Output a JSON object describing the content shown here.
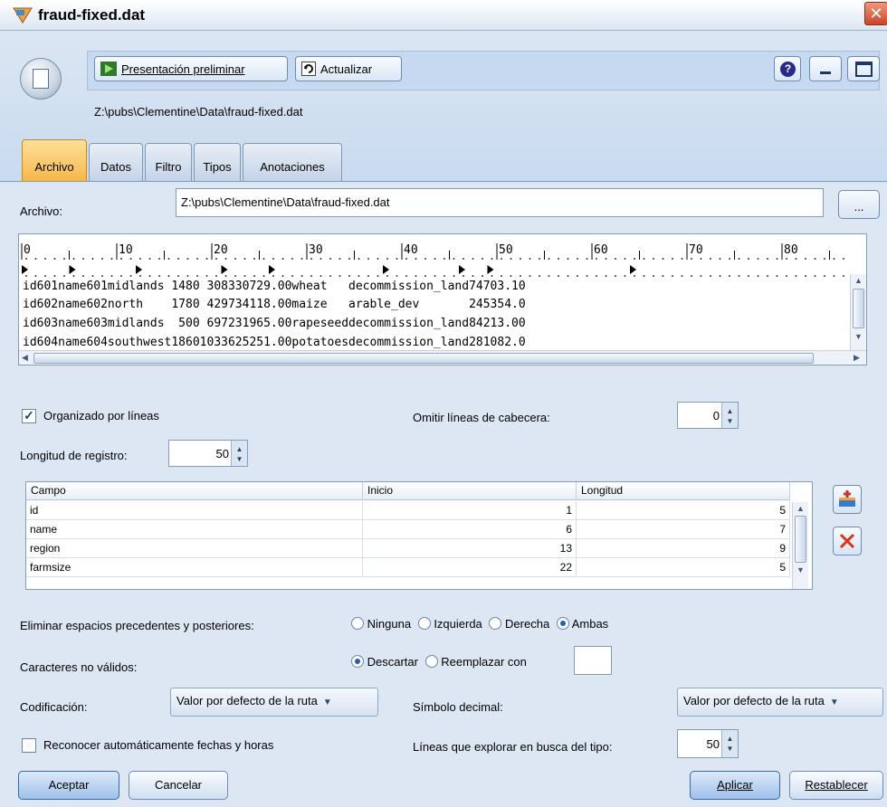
{
  "window": {
    "title": "fraud-fixed.dat",
    "close_glyph": "✕"
  },
  "toolbar": {
    "preview_label": "Presentación preliminar",
    "refresh_label": "Actualizar",
    "help_glyph": "?",
    "path": "Z:\\pubs\\Clementine\\Data\\fraud-fixed.dat"
  },
  "tabs": [
    {
      "label": "Archivo",
      "active": true
    },
    {
      "label": "Datos"
    },
    {
      "label": "Filtro"
    },
    {
      "label": "Tipos"
    },
    {
      "label": "Anotaciones"
    }
  ],
  "file": {
    "label": "Archivo:",
    "value": "Z:\\pubs\\Clementine\\Data\\fraud-fixed.dat",
    "browse_label": "..."
  },
  "preview": {
    "ruler_numbers": [
      "0",
      "10",
      "20",
      "30",
      "40",
      "50",
      "60",
      "70",
      "80"
    ],
    "lines": [
      "id601name601midlands 1480 308330729.00wheat   decommission_land74703.10",
      "id602name602north    1780 429734118.00maize   arable_dev       245354.0",
      "id603name603midlands  500 697231965.00rapeseeddecommission_land84213.00",
      "id604name604southwest18601033625251.00potatoesdecommission_land281082.0"
    ]
  },
  "options": {
    "line_oriented_label": "Organizado por líneas",
    "line_oriented_checked": true,
    "skip_header_label": "Omitir líneas de cabecera:",
    "skip_header_value": "0",
    "record_length_label": "Longitud de registro:",
    "record_length_value": "50"
  },
  "fields_table": {
    "headers": [
      "Campo",
      "Inicio",
      "Longitud"
    ],
    "rows": [
      {
        "field": "id",
        "start": "1",
        "length": "5"
      },
      {
        "field": "name",
        "start": "6",
        "length": "7"
      },
      {
        "field": "region",
        "start": "13",
        "length": "9"
      },
      {
        "field": "farmsize",
        "start": "22",
        "length": "5"
      }
    ]
  },
  "trim": {
    "label": "Eliminar espacios precedentes y posteriores:",
    "options": [
      "Ninguna",
      "Izquierda",
      "Derecha",
      "Ambas"
    ],
    "selected": "Ambas"
  },
  "invalid_chars": {
    "label": "Caracteres no válidos:",
    "options": [
      "Descartar",
      "Reemplazar con"
    ],
    "selected": "Descartar",
    "replace_value": ""
  },
  "encoding": {
    "label": "Codificación:",
    "value": "Valor por defecto de la ruta"
  },
  "decimal": {
    "label": "Símbolo decimal:",
    "value": "Valor por defecto de la ruta"
  },
  "auto_dates": {
    "label": "Reconocer automáticamente fechas y horas",
    "checked": false
  },
  "scan_lines": {
    "label": "Líneas que explorar en busca del tipo:",
    "value": "50"
  },
  "footer": {
    "ok": "Aceptar",
    "cancel": "Cancelar",
    "apply": "Aplicar",
    "reset": "Restablecer"
  },
  "colors": {
    "accent": "#2a5bbf",
    "active_tab": "#f6b94a",
    "background": "#dde7f4"
  }
}
